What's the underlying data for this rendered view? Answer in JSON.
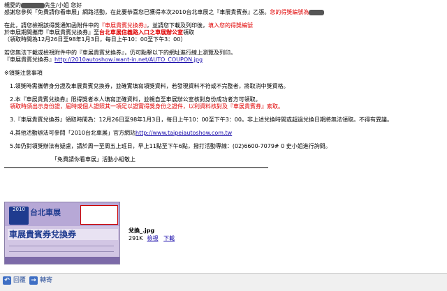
{
  "email": {
    "greeting_pre": "親愛的",
    "greeting_post": "先生/小姐  您好",
    "line1_text": "感謝您參與「免費請你看車展」網路活動，在此要恭喜您已獲得本次2010台北車展之『車展貴賓券』乙張。",
    "line1_red": "您的得獎編號為",
    "para2_l1_pre": "在此，請您檢視該得獎通知函附件中的",
    "para2_l1_red": "『車展貴賓兌換券』",
    "para2_l1_mid": "，並請您下載及列印後，",
    "para2_l1_red2": "填入您的得獎編號",
    "para2_l2_pre": "於車展期間攜帶『車展貴賓兌換券』至",
    "para2_l2_red": "台北車展信義路入口之車展辦公室",
    "para2_l2_post": "領取",
    "para2_l3": "（領取時間為12月26日至98年1月3日，每日上午10：00至下午3：00）",
    "para3_l1": "若您無法下載或檢視附件中的『車展貴賓兌換券』，仍可點擊以下的網址進行線上瀏覽及列印。",
    "para3_l2_pre": "『車展貴賓兌換券』",
    "para3_link": "http://2010autoshow.iwant-in.net/AUTO_COUPON.jpg",
    "notes_title": "※領獎注意事項",
    "note1": "1.領獎時需攜帶身分證及車展貴賓兌換券，並確實填寫領獎資料，若發現資料不符或不完整者，將取消中獎資格。",
    "note2_l1": "2.本『車展貴賓兌換券』限得獎者本人填寫正確資料，並親自至車展辦公室核對身份成功者方可領取。",
    "note2_l2": "領取時須出示身份證，屆時或個人證照其一項足以證實得獎身份之證件，以利資料核對及『車展貴賓券』索取。",
    "note3": "3.『車展貴賓兌換券』領取時間為：12月26日至98年1月3日，每日上午10：00至下午3：00。非上述兌換時間或超過兌換日期將無法領取。不得有異議。",
    "note4_pre": "4.其他活動辦法可參閱「2010台北車展」官方網站",
    "note4_link": "http://www.taipeiautoshow.com.tw",
    "note5": "5.如仍對領獎辦法有疑慮，請於周一至周五上班日，早上11點至下午6點，撥打活動專線：(02)6600-7079# 0 史小姐進行詢問。",
    "signature": "「免費請你看車展」活動小組敬上"
  },
  "attachment": {
    "coupon_logo_year": "2010",
    "coupon_brand": "台北車展",
    "coupon_title": "車展貴賓券兌換券",
    "file_name": "兌換_.jpg",
    "file_size": "291K",
    "view_label": "檢視",
    "download_label": "下載"
  },
  "toolbar": {
    "reply_label": "回覆",
    "forward_label": "轉寄"
  }
}
